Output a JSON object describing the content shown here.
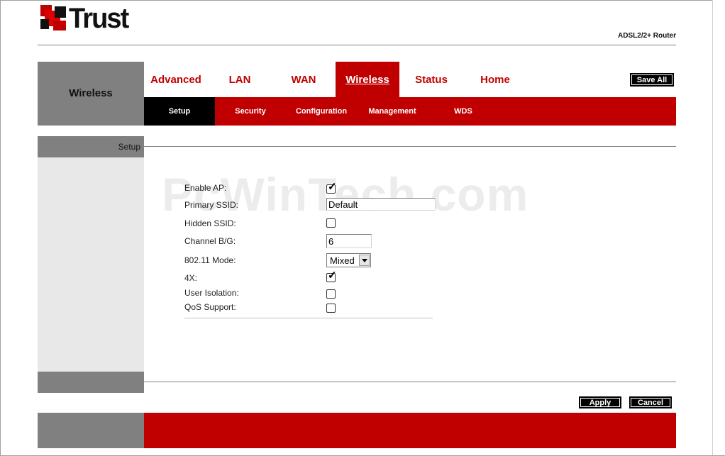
{
  "brand": {
    "name": "Trust",
    "product": "ADSL2/2+ Router"
  },
  "section": {
    "title": "Wireless"
  },
  "nav": {
    "tabs": [
      {
        "label": "Advanced",
        "active": false
      },
      {
        "label": "LAN",
        "active": false
      },
      {
        "label": "WAN",
        "active": false
      },
      {
        "label": "Wireless",
        "active": true
      },
      {
        "label": "Status",
        "active": false
      },
      {
        "label": "Home",
        "active": false
      }
    ],
    "save_all": "Save All"
  },
  "subnav": {
    "tabs": [
      {
        "label": "Setup",
        "active": true
      },
      {
        "label": "Security",
        "active": false
      },
      {
        "label": "Configuration",
        "active": false
      },
      {
        "label": "Management",
        "active": false
      },
      {
        "label": "WDS",
        "active": false
      }
    ]
  },
  "page": {
    "left_label": "Setup"
  },
  "watermark": "PcWinTech.com",
  "form": {
    "enable_ap": {
      "label": "Enable AP:",
      "checked": true
    },
    "primary_ssid": {
      "label": "Primary SSID:",
      "value": "Default"
    },
    "hidden_ssid": {
      "label": "Hidden SSID:",
      "checked": false
    },
    "channel_bg": {
      "label": "Channel B/G:",
      "value": "6"
    },
    "mode": {
      "label": "802.11 Mode:",
      "value": "Mixed"
    },
    "four_x": {
      "label": "4X:",
      "checked": true
    },
    "user_isolation": {
      "label": "User Isolation:",
      "checked": false
    },
    "qos_support": {
      "label": "QoS Support:",
      "checked": false
    }
  },
  "actions": {
    "apply": "Apply",
    "cancel": "Cancel"
  },
  "colors": {
    "accent": "#c00000",
    "gray": "#808080",
    "light_gray": "#e8e8e8",
    "black": "#000000"
  }
}
